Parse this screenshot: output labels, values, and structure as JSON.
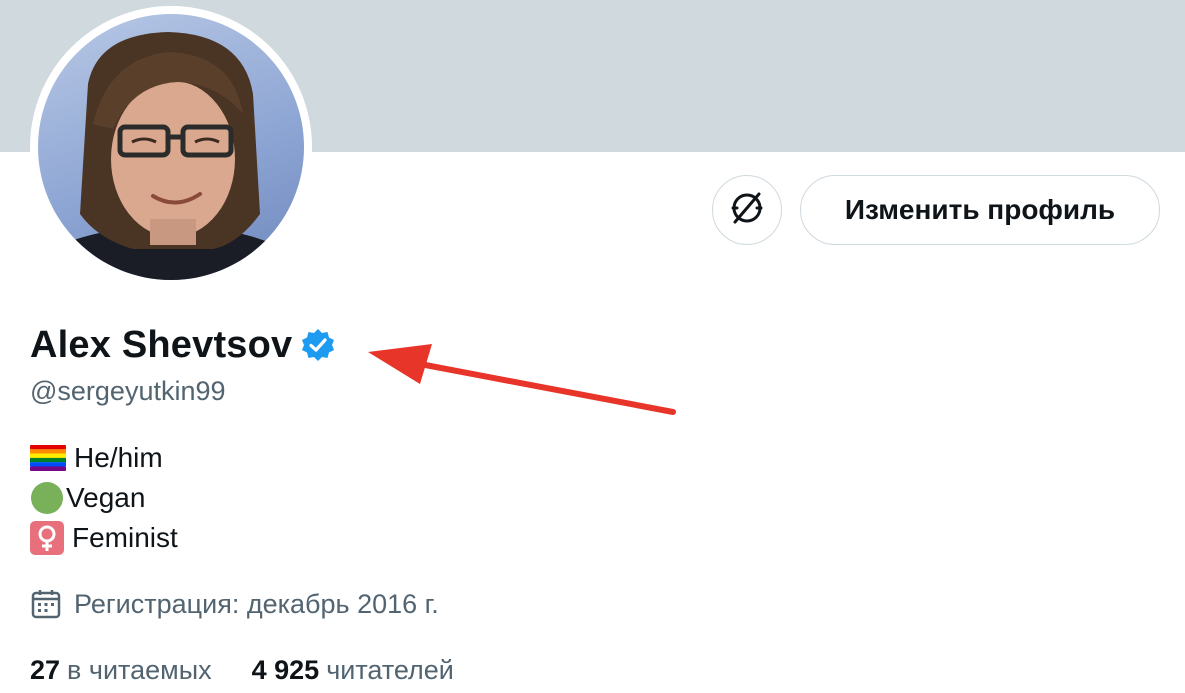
{
  "profile": {
    "display_name": "Alex Shevtsov",
    "handle": "@sergeyutkin99",
    "verified_icon": "verified-badge-icon",
    "avatar_icon": "avatar-photo"
  },
  "actions": {
    "edit_profile_label": "Изменить профиль",
    "round_button_icon": "no-sync-icon"
  },
  "bio": [
    {
      "emoji": "rainbow-flag-icon",
      "text": "He/him"
    },
    {
      "emoji": "green-circle-icon",
      "text": "Vegan"
    },
    {
      "emoji": "female-sign-icon",
      "text": "Feminist"
    }
  ],
  "join": {
    "icon": "calendar-icon",
    "text": "Регистрация: декабрь 2016 г."
  },
  "stats": {
    "following_count": "27",
    "following_label": "в читаемых",
    "followers_count": "4 925",
    "followers_label": "читателей"
  },
  "annotation": {
    "arrow_color": "#e8352a"
  },
  "colors": {
    "banner": "#cfd9de",
    "verified": "#1d9bf0",
    "muted_text": "#536471",
    "text": "#0f1419"
  }
}
